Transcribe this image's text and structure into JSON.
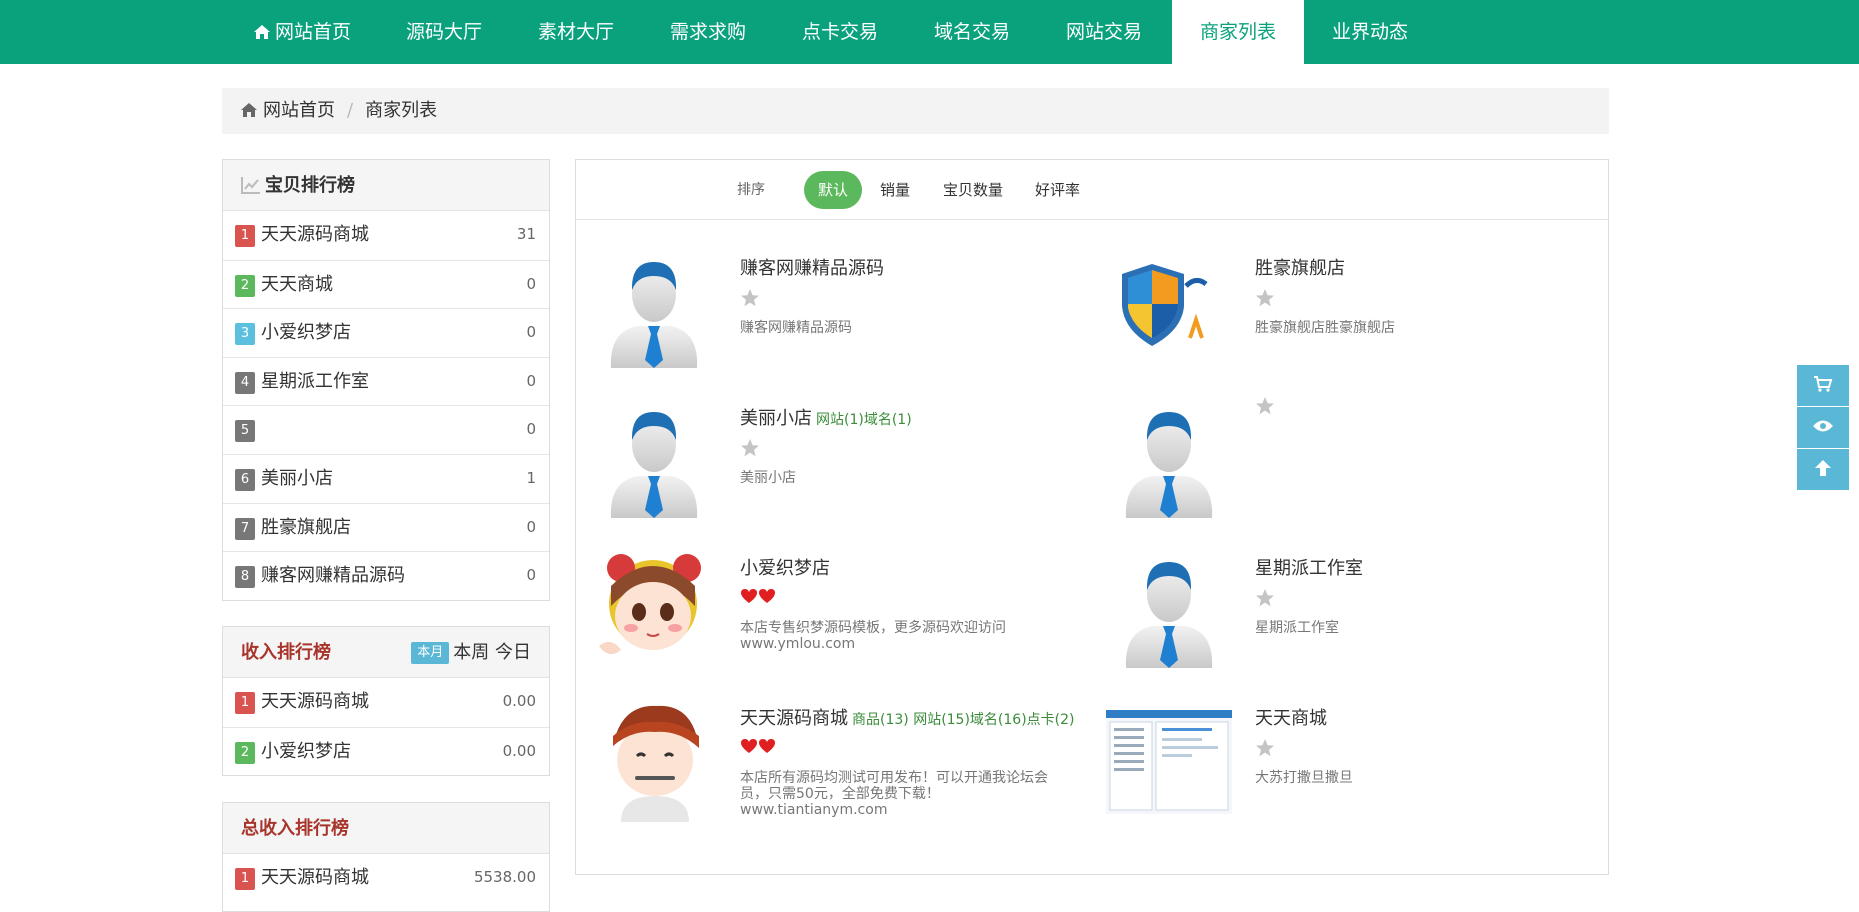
{
  "nav": {
    "items": [
      "网站首页",
      "源码大厅",
      "素材大厅",
      "需求求购",
      "点卡交易",
      "域名交易",
      "网站交易",
      "商家列表",
      "业界动态"
    ],
    "active_index": 7
  },
  "breadcrumb": {
    "home": "网站首页",
    "current": "商家列表"
  },
  "product_rank": {
    "title": "宝贝排行榜",
    "rows": [
      {
        "num": "1",
        "name": "天天源码商城",
        "value": "31"
      },
      {
        "num": "2",
        "name": "天天商城",
        "value": "0"
      },
      {
        "num": "3",
        "name": "小爱织梦店",
        "value": "0"
      },
      {
        "num": "4",
        "name": "星期派工作室",
        "value": "0"
      },
      {
        "num": "5",
        "name": "",
        "value": "0"
      },
      {
        "num": "6",
        "name": "美丽小店",
        "value": "1"
      },
      {
        "num": "7",
        "name": "胜豪旗舰店",
        "value": "0"
      },
      {
        "num": "8",
        "name": "赚客网赚精品源码",
        "value": "0"
      }
    ]
  },
  "income_rank": {
    "title": "收入排行榜",
    "period_active": "本月",
    "period_week": "本周",
    "period_today": "今日",
    "rows": [
      {
        "num": "1",
        "name": "天天源码商城",
        "value": "0.00"
      },
      {
        "num": "2",
        "name": "小爱织梦店",
        "value": "0.00"
      }
    ]
  },
  "total_income_rank": {
    "title": "总收入排行榜",
    "rows": [
      {
        "num": "1",
        "name": "天天源码商城",
        "value": "5538.00"
      }
    ]
  },
  "sort": {
    "label": "排序",
    "options": [
      "默认",
      "销量",
      "宝贝数量",
      "好评率"
    ]
  },
  "shops": [
    {
      "name": "赚客网赚精品源码",
      "tags": "",
      "desc": "赚客网赚精品源码",
      "stars": 0,
      "hearts": 0,
      "avatar": "default"
    },
    {
      "name": "胜豪旗舰店",
      "tags": "",
      "desc": "胜豪旗舰店胜豪旗舰店",
      "stars": 0,
      "hearts": 0,
      "avatar": "shield"
    },
    {
      "name": "美丽小店",
      "tags": "网站(1)域名(1)",
      "desc": "美丽小店",
      "stars": 0,
      "hearts": 0,
      "avatar": "default"
    },
    {
      "name": "",
      "tags": "",
      "desc": "",
      "stars": 0,
      "hearts": 0,
      "avatar": "default"
    },
    {
      "name": "小爱织梦店",
      "tags": "",
      "desc": "本店专售织梦源码模板，更多源码欢迎访问www.ymlou.com",
      "stars": 0,
      "hearts": 2,
      "avatar": "girl"
    },
    {
      "name": "星期派工作室",
      "tags": "",
      "desc": "星期派工作室",
      "stars": 0,
      "hearts": 0,
      "avatar": "default"
    },
    {
      "name": "天天源码商城",
      "tags": "商品(13) 网站(15)域名(16)点卡(2)",
      "desc": "本店所有源码均测试可用发布！可以开通我论坛会员，只需50元，全部免费下载！www.tiantianym.com",
      "stars": 0,
      "hearts": 2,
      "avatar": "boy"
    },
    {
      "name": "天天商城",
      "tags": "",
      "desc": "大苏打撒旦撒旦",
      "stars": 0,
      "hearts": 0,
      "avatar": "screenshot"
    }
  ],
  "colors": {
    "nav_bg": "#0aa17d",
    "rank_1": "#d9534f",
    "rank_2": "#5cb85c",
    "rank_3": "#5bc0de",
    "rank_other": "#777777",
    "sort_active": "#5cb85c",
    "float_tools": "#5bb7d6"
  },
  "float_tools": [
    "cart-icon",
    "eye-icon",
    "arrow-up-icon"
  ]
}
